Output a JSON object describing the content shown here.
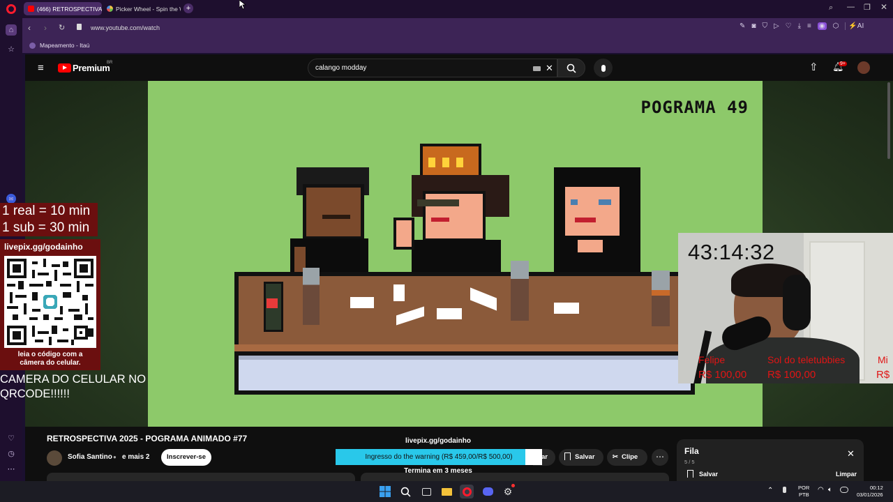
{
  "browser": {
    "tabs": [
      {
        "label": "(466) RETROSPECTIVA 20...",
        "active": true
      },
      {
        "label": "Picker Wheel - Spin the W",
        "active": false
      }
    ],
    "new_tab": "+",
    "url": "www.youtube.com/watch",
    "bookmark": "Mapeamento - Itaú",
    "toolbar_right_label": "AI"
  },
  "youtube": {
    "logo": "Premium",
    "region": "BR",
    "search_value": "calango modday",
    "notifications_badge": "9+",
    "video_title": "RETROSPECTIVA 2025 - POGRAMA ANIMADO #77",
    "channel": "Sofia Santino",
    "channel_suffix": "e mais 2",
    "subscribe": "Inscrever-se",
    "save": "Salvar",
    "clip": "Clipe",
    "partial_button": "ar",
    "queue": {
      "title": "Fila",
      "count": "5 / 5",
      "save": "Salvar",
      "clear": "Limpar"
    }
  },
  "scene": {
    "title": "POGRAMA 49"
  },
  "overlay": {
    "rate1": "1 real = 10 min",
    "rate2": "1 sub = 30 min",
    "livepix": "livepix.gg/godainho",
    "qr_caption": "leia o código com a câmera do celular.",
    "camera_msg": "CAMERA DO CELULAR NO QRCODE!!!!!!",
    "timer": "43:14:32",
    "goal_title": "livepix.gg/godainho",
    "goal_text": "Ingresso do the warning (R$ 459,00/R$ 500,00)",
    "goal_progress": 0.918,
    "goal_footer": "Termina em 3 meses",
    "donations": [
      {
        "name": "Felipe",
        "amount": "R$ 100,00"
      },
      {
        "name": "Sol do teletubbies",
        "amount": "R$ 100,00"
      },
      {
        "name": "Mi",
        "amount": "R$"
      }
    ]
  },
  "taskbar": {
    "lang1": "POR",
    "lang2": "PTB",
    "time": "00:12",
    "date": "03/01/2026"
  },
  "colors": {
    "scene_bg": "#8dc96a",
    "goal_bar": "#29c8ea",
    "opera_red": "#ff1b2d",
    "yt_red": "#ff0000"
  }
}
